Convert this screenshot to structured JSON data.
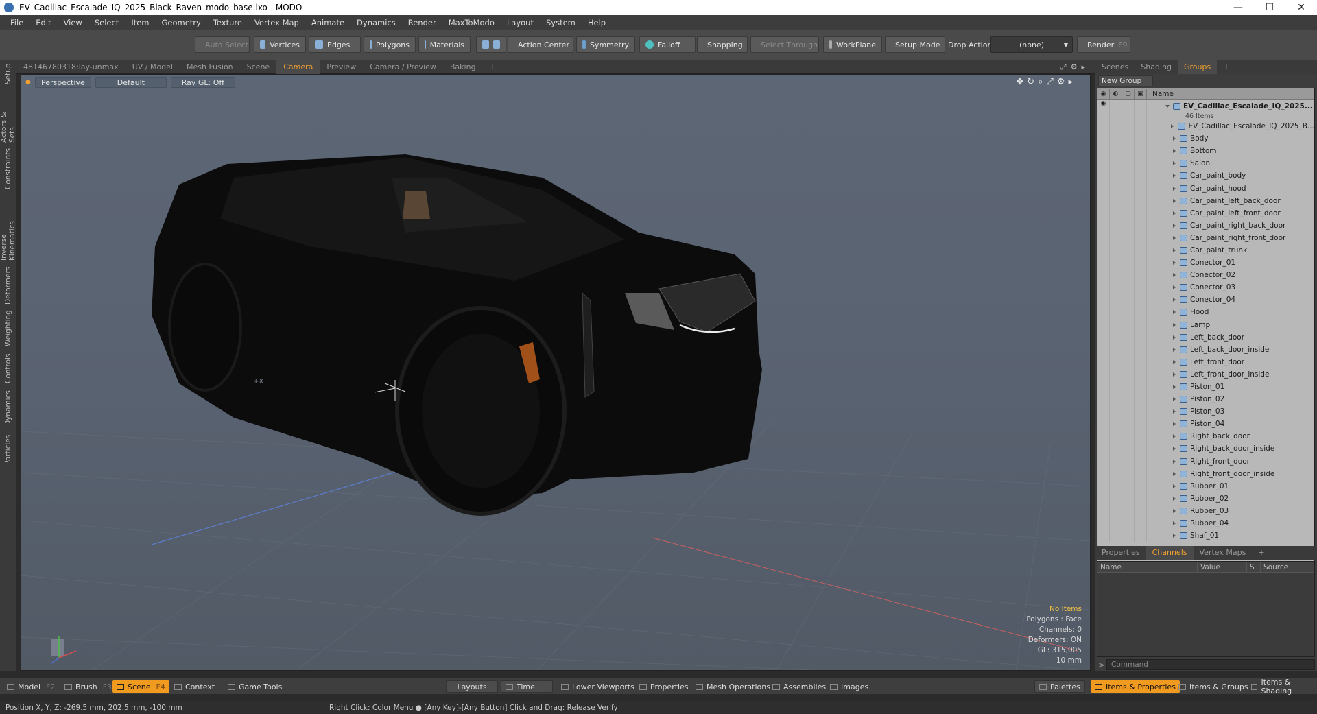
{
  "window": {
    "title": "EV_Cadillac_Escalade_IQ_2025_Black_Raven_modo_base.lxo - MODO",
    "controls": [
      "—",
      "☐",
      "✕"
    ]
  },
  "menu": [
    "File",
    "Edit",
    "View",
    "Select",
    "Item",
    "Geometry",
    "Texture",
    "Vertex Map",
    "Animate",
    "Dynamics",
    "Render",
    "MaxToModo",
    "Layout",
    "System",
    "Help"
  ],
  "toolbar": {
    "auto_select": "Auto Select",
    "vertices": "Vertices",
    "edges": "Edges",
    "polygons": "Polygons",
    "materials": "Materials",
    "action_center": "Action Center",
    "symmetry": "Symmetry",
    "falloff": "Falloff",
    "snapping": "Snapping",
    "select_through": "Select Through",
    "workplane": "WorkPlane",
    "setup_mode": "Setup Mode",
    "drop_action": "Drop Action",
    "drop_action_value": "(none)",
    "render": "Render",
    "render_key": "F9"
  },
  "left_tabs": [
    "Setup",
    "Actors & Sets",
    "Constraints",
    "Inverse Kinematics",
    "Deformers",
    "Weighting",
    "Controls",
    "Dynamics",
    "Particles"
  ],
  "viewport_tabs": {
    "items": [
      "481467803​18:lay-unmax",
      "UV / Model",
      "Mesh Fusion",
      "Scene",
      "Camera",
      "Preview",
      "Camera / Preview",
      "Baking",
      "+"
    ],
    "active": "Camera"
  },
  "viewport": {
    "view_mode": "Perspective",
    "shading": "Default",
    "raygl": "Ray GL: Off",
    "stats": {
      "no_items": "No Items",
      "polygons": "Polygons : Face",
      "channels": "Channels: 0",
      "deformers": "Deformers: ON",
      "gl": "GL: 315,005",
      "scale": "10 mm"
    },
    "axis_label": "+X"
  },
  "right_tabs": {
    "items": [
      "Scenes",
      "Shading",
      "Groups",
      "+"
    ],
    "active": "Groups"
  },
  "groups": {
    "new_group": "New Group",
    "name_header": "Name",
    "root": "EV_Cadillac_Escalade_IQ_2025...",
    "root_count": "46 Items",
    "items": [
      "EV_Cadillac_Escalade_IQ_2025_B...",
      "Body",
      "Bottom",
      "Salon",
      "Car_paint_body",
      "Car_paint_hood",
      "Car_paint_left_back_door",
      "Car_paint_left_front_door",
      "Car_paint_right_back_door",
      "Car_paint_right_front_door",
      "Car_paint_trunk",
      "Conector_01",
      "Conector_02",
      "Conector_03",
      "Conector_04",
      "Hood",
      "Lamp",
      "Left_back_door",
      "Left_back_door_inside",
      "Left_front_door",
      "Left_front_door_inside",
      "Piston_01",
      "Piston_02",
      "Piston_03",
      "Piston_04",
      "Right_back_door",
      "Right_back_door_inside",
      "Right_front_door",
      "Right_front_door_inside",
      "Rubber_01",
      "Rubber_02",
      "Rubber_03",
      "Rubber_04",
      "Shaf_01"
    ]
  },
  "properties_tabs": {
    "items": [
      "Properties",
      "Channels",
      "Vertex Maps",
      "+"
    ],
    "active": "Channels"
  },
  "channels_table": {
    "headers": [
      "Name",
      "Value",
      "S",
      "Source"
    ]
  },
  "command": {
    "placeholder": "Command"
  },
  "bottom": {
    "model": "Model",
    "model_key": "F2",
    "brush": "Brush",
    "brush_key": "F3",
    "scene": "Scene",
    "scene_key": "F4",
    "context": "Context",
    "game_tools": "Game Tools",
    "layouts": "Layouts",
    "time": "Time",
    "lower_viewports": "Lower Viewports",
    "properties": "Properties",
    "mesh_operations": "Mesh Operations",
    "assemblies": "Assemblies",
    "images": "Images",
    "palettes": "Palettes",
    "items_properties": "Items & Properties",
    "items_groups": "Items & Groups",
    "items_shading": "Items & Shading"
  },
  "status": {
    "position": "Position X, Y, Z:   -269.5 mm, 202.5 mm, -100 mm",
    "hint": "Right Click: Color Menu ● [Any Key]-[Any Button] Click and Drag: Release Verify"
  },
  "colors": {
    "accent": "#f09a20",
    "viewport_bg": "#5a6372",
    "car_body": "#0c0c0c"
  }
}
